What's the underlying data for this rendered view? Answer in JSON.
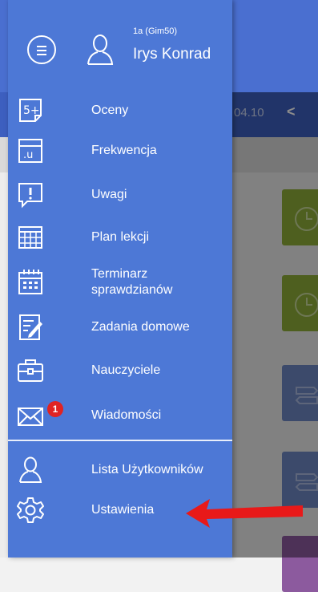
{
  "background": {
    "date_fragment": "04.10",
    "prev_arrow": "<"
  },
  "header": {
    "class_label": "1a (Gim50)",
    "user_name": "Irys Konrad"
  },
  "menu": {
    "items": [
      {
        "label": "Oceny",
        "icon": "grades-icon"
      },
      {
        "label": "Frekwencja",
        "icon": "attendance-icon"
      },
      {
        "label": "Uwagi",
        "icon": "remarks-icon"
      },
      {
        "label": "Plan lekcji",
        "icon": "timetable-icon"
      },
      {
        "label": "Terminarz sprawdzianów",
        "icon": "calendar-icon"
      },
      {
        "label": "Zadania domowe",
        "icon": "homework-icon"
      },
      {
        "label": "Nauczyciele",
        "icon": "briefcase-icon"
      },
      {
        "label": "Wiadomości",
        "icon": "envelope-icon",
        "badge": "1"
      }
    ],
    "bottom_items": [
      {
        "label": "Lista Użytkowników",
        "icon": "user-list-icon"
      },
      {
        "label": "Ustawienia",
        "icon": "gear-icon"
      }
    ]
  },
  "colors": {
    "drawer": "#4d78d6",
    "badge": "#e02323",
    "arrow": "#e81919",
    "tile_green": "#8fae3a",
    "tile_blue": "#6d88c3"
  }
}
